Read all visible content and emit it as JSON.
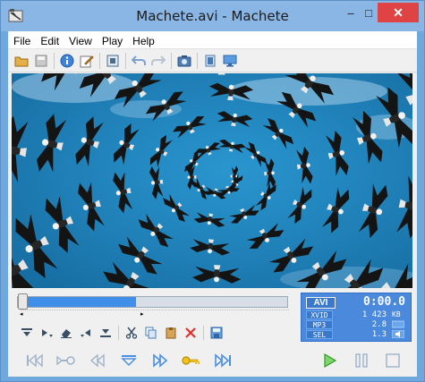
{
  "window": {
    "title": "Machete.avi - Machete",
    "buttons": {
      "minimize": "–",
      "maximize": "□",
      "close": "✕"
    }
  },
  "menu": [
    "File",
    "Edit",
    "View",
    "Play",
    "Help"
  ],
  "toolbar": {
    "icons": [
      "open-folder-icon",
      "save-icon",
      "info-icon",
      "edit-tags-icon",
      "video-frames-icon",
      "undo-icon",
      "redo-icon",
      "camera-snapshot-icon",
      "fullscreen-icon",
      "display-icon"
    ]
  },
  "seek": {
    "position_fraction": 0.44,
    "start_marker": "◂",
    "end_marker": "▸"
  },
  "info": {
    "container": "AVI",
    "time": "0:00.0",
    "rows": [
      {
        "label": "XVID",
        "value": "1 423",
        "unit": "KB"
      },
      {
        "label": "MP3",
        "value": "2.8",
        "unit": ""
      },
      {
        "label": "SEL",
        "value": "1.3",
        "unit": ""
      }
    ]
  },
  "edit_toolbar": {
    "icons": [
      "mark-in-icon",
      "mark-in-dropdown-icon",
      "erase-icon",
      "mark-out-icon",
      "mark-out-dropdown-icon",
      "cut-icon",
      "copy-icon",
      "paste-icon",
      "delete-icon",
      "save-selection-icon"
    ]
  },
  "playback": {
    "icons": [
      "go-to-start-icon",
      "keyframe-back-icon",
      "step-back-icon",
      "go-to-marker-icon",
      "step-forward-icon",
      "keyframe-forward-icon",
      "go-to-end-icon",
      "play-icon",
      "pause-icon",
      "stop-icon"
    ]
  },
  "colors": {
    "accent": "#3f8fe8",
    "title_bar": "#8ab6e6",
    "close_button": "#e04343",
    "info_panel": "#4a89dc",
    "video_sky": "#1f7fb6"
  }
}
